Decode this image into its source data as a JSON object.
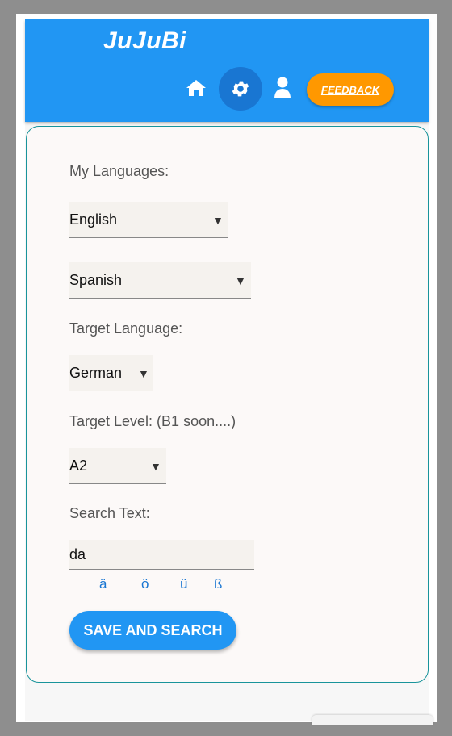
{
  "header": {
    "logo": "JuJuBi",
    "feedback_label": "FEEDBACK",
    "icons": [
      "home-icon",
      "gear-icon",
      "user-icon"
    ]
  },
  "form": {
    "my_languages_label": "My Languages:",
    "language_1": "English",
    "language_2": "Spanish",
    "target_language_label": "Target Language:",
    "target_language": "German",
    "target_level_label": "Target Level: (B1 soon....)",
    "target_level": "A2",
    "search_text_label": "Search Text:",
    "search_text": "da",
    "special_chars": [
      "ä",
      "ö",
      "ü",
      "ß"
    ],
    "save_label": "SAVE AND SEARCH"
  },
  "colors": {
    "appbar": "#2196f3",
    "gear_active": "#1976d2",
    "feedback": "#ff9800",
    "card_border": "#19949b"
  }
}
